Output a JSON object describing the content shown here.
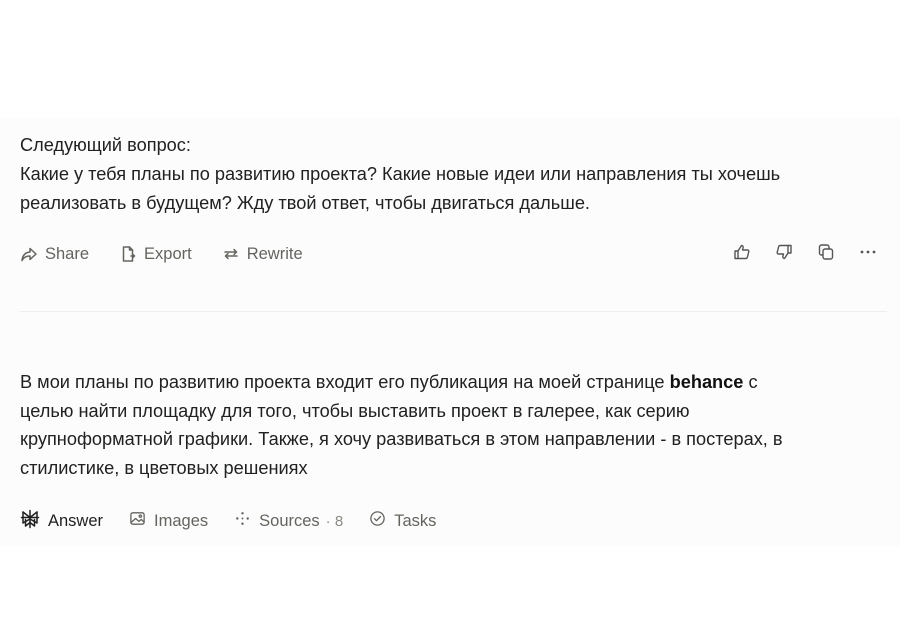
{
  "question": {
    "lines": [
      "Следующий вопрос:",
      "Какие у тебя планы по развитию проекта? Какие новые идеи или направления ты хочешь",
      "реализовать в будущем? Жду твой ответ, чтобы двигаться дальше."
    ]
  },
  "toolbar": {
    "share_label": "Share",
    "export_label": "Export",
    "rewrite_label": "Rewrite"
  },
  "answer": {
    "line1_before": "В мои планы по развитию проекта входит его публикация на моей странице ",
    "line1_bold": "behance",
    "line1_after": " с",
    "line2": "целью найти площадку для того, чтобы выставить проект в галерее, как серию",
    "line3": "крупноформатной графики. Также, я хочу развиваться в этом направлении - в постерах, в",
    "line4": "стилистике, в цветовых решениях"
  },
  "tabs": {
    "answer_label": "Answer",
    "images_label": "Images",
    "sources_label": "Sources",
    "sources_count": "· 8",
    "tasks_label": "Tasks"
  },
  "icons": {
    "share": "share-arrow-icon",
    "export": "export-file-icon",
    "rewrite": "rewrite-arrows-icon",
    "thumbs_up": "thumbs-up-icon",
    "thumbs_down": "thumbs-down-icon",
    "copy": "copy-icon",
    "more": "more-dots-icon",
    "answer": "answer-logo-icon",
    "images": "image-icon",
    "sources": "sources-sparkle-icon",
    "tasks": "tasks-check-icon"
  },
  "colors": {
    "text": "#202121",
    "muted": "#64645f",
    "panel": "#fcfcfc",
    "divider": "#eeeeee"
  }
}
